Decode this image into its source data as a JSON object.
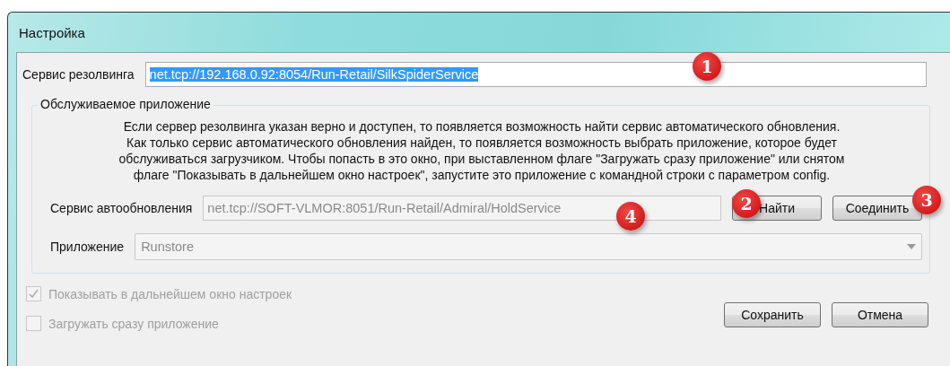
{
  "window": {
    "title": "Настройка"
  },
  "resolving_service": {
    "label": "Сервис резолвинга",
    "value": "net.tcp://192.168.0.92:8054/Run-Retail/SilkSpiderService",
    "selected": true
  },
  "group": {
    "title": "Обслуживаемое приложение",
    "description_lines": [
      "Если сервер резолвинга указан верно и доступен, то появляется возможность найти сервис автоматического обновления.",
      "Как только сервис автоматического обновления найден, то появляется возможность выбрать приложение, которое будет",
      "обслуживаться загрузчиком. Чтобы попасть в это окно, при выставленном флаге \"Загружать сразу приложение\" или снятом",
      "флаге \"Показывать в дальнейшем окно настроек\", запустите это приложение с командной строки с параметром config."
    ],
    "update_service": {
      "label": "Сервис автообновления",
      "value": "net.tcp://SOFT-VLMOR:8051/Run-Retail/Admiral/HoldService",
      "disabled": true
    },
    "buttons": [
      {
        "label": "Найти"
      },
      {
        "label": "Соединить"
      }
    ],
    "application": {
      "label": "Приложение",
      "value": "Runstore",
      "disabled": true
    }
  },
  "checkboxes": [
    {
      "label": "Показывать в дальнейшем окно настроек",
      "checked": true,
      "disabled": true
    },
    {
      "label": "Загружать сразу приложение",
      "checked": false,
      "disabled": true
    }
  ],
  "buttons": [
    "Сохранить",
    "Отмена"
  ],
  "callouts": [
    "1",
    "4",
    "2",
    "3"
  ]
}
